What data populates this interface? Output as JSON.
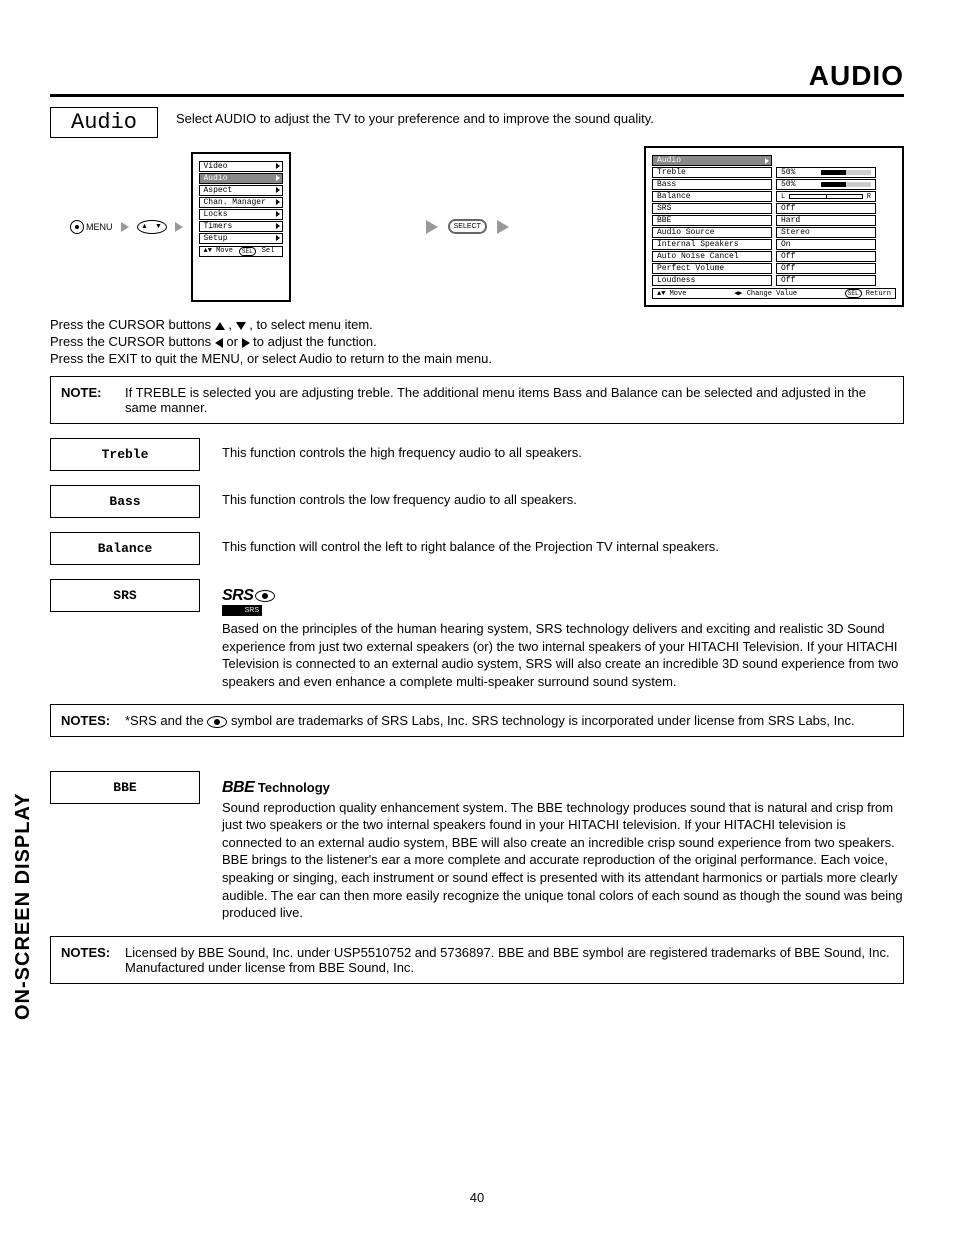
{
  "page": {
    "title": "AUDIO",
    "number": "40",
    "side_tab": "ON-SCREEN DISPLAY"
  },
  "header": {
    "box_label": "Audio",
    "intro": "Select AUDIO to adjust the TV to your preference and to improve the sound quality."
  },
  "nav": {
    "menu_label": "MENU",
    "select_label": "SELECT",
    "rocker_up": "▲",
    "rocker_down": "▼"
  },
  "osd1": {
    "items": [
      "Video",
      "Audio",
      "Aspect",
      "Chan. Manager",
      "Locks",
      "Timers",
      "Setup"
    ],
    "sel_index": 1,
    "footer_move": "Move",
    "footer_sel": "Sel",
    "footer_sel_btn": "SEL"
  },
  "osd2": {
    "title": "Audio",
    "rows": [
      {
        "label": "Treble",
        "val": "50%",
        "bar": 50
      },
      {
        "label": "Bass",
        "val": "50%",
        "bar": 50
      },
      {
        "label": "Balance",
        "val": "",
        "balance": true,
        "l": "L",
        "r": "R"
      },
      {
        "label": "SRS",
        "val": "Off"
      },
      {
        "label": "BBE",
        "val": "Hard"
      },
      {
        "label": "Audio Source",
        "val": "Stereo"
      },
      {
        "label": "Internal Speakers",
        "val": "On"
      },
      {
        "label": "Auto Noise Cancel",
        "val": "Off"
      },
      {
        "label": "Perfect Volume",
        "val": "Off"
      },
      {
        "label": "Loudness",
        "val": "Off"
      }
    ],
    "footer_move": "Move",
    "footer_change": "Change Value",
    "footer_sel": "SEL",
    "footer_return": "Return"
  },
  "instructions": {
    "l1a": "Press the CURSOR buttons ",
    "l1b": ", ",
    "l1c": ", to select menu item.",
    "l2a": "Press the CURSOR buttons  ",
    "l2b": " or ",
    "l2c": " to adjust the function.",
    "l3": "Press the EXIT to quit the MENU, or select Audio to return to the main menu."
  },
  "note1": {
    "label": "NOTE:",
    "text": "If TREBLE is selected you are adjusting treble.  The additional menu items Bass and Balance can be selected and adjusted in the same manner."
  },
  "funcs": {
    "treble": {
      "label": "Treble",
      "desc": "This function controls the high frequency audio to all speakers."
    },
    "bass": {
      "label": "Bass",
      "desc": "This function controls the low frequency audio to all speakers."
    },
    "balance": {
      "label": "Balance",
      "desc": "This function will control the left to right balance of the Projection TV internal speakers."
    },
    "srs": {
      "label": "SRS",
      "logo_text": "SRS",
      "sub": "SRS",
      "desc": "Based on the principles of the human hearing system, SRS technology delivers and exciting and realistic 3D Sound experience from just two external speakers (or) the two internal speakers of your HITACHI Television.  If your HITACHI Television is connected to an external audio system, SRS will also create an incredible 3D sound experience from two speakers and even enhance a complete multi-speaker surround sound system."
    },
    "bbe": {
      "label": "BBE",
      "logo_text": "BBE",
      "tech": " Technology",
      "desc": "Sound reproduction quality enhancement system.  The BBE technology produces sound that is natural and crisp from just two speakers or the two internal speakers found in your HITACHI television. If your HITACHI television is connected to an external audio system, BBE will also create an incredible crisp sound experience from two speakers.  BBE brings to the listener's ear a more complete and accurate reproduction of the original performance.  Each voice, speaking or singing, each instrument or sound effect is presented with its attendant harmonics or partials more clearly audible.  The ear can then more easily recognize the unique tonal colors of each sound as though the sound was being produced live."
    }
  },
  "note_srs": {
    "label": "NOTES:",
    "t1": "*SRS and the ",
    "t2": " symbol are trademarks of SRS Labs, Inc. SRS technology is incorporated under license from SRS Labs, Inc."
  },
  "note_bbe": {
    "label": "NOTES:",
    "text": "Licensed by BBE Sound, Inc. under USP5510752 and 5736897.  BBE and BBE symbol are registered trademarks of BBE Sound, Inc.  Manufactured under license from BBE Sound, Inc."
  }
}
